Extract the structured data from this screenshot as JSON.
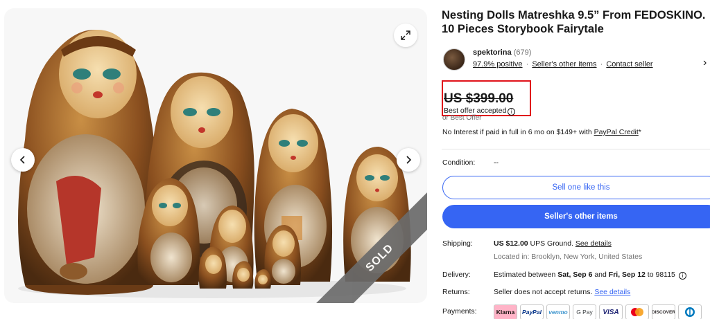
{
  "listing": {
    "title": "Nesting Dolls Matreshka 9.5” From FEDOSKINO. 10 Pieces Storybook Fairytale",
    "sold_ribbon": "SOLD"
  },
  "seller": {
    "name": "spektorina",
    "feedback_count": "(679)",
    "positive": "97.9% positive",
    "other_items_link": "Seller's other items",
    "contact_link": "Contact seller",
    "chevron": "›"
  },
  "pricing": {
    "price": "US $399.00",
    "offer_status": "Best offer accepted",
    "or_best_offer": "or Best Offer",
    "credit_text": "No Interest if paid in full in 6 mo on $149+ with ",
    "credit_link": "PayPal Credit",
    "credit_suffix": "*"
  },
  "condition": {
    "label": "Condition:",
    "value": "--"
  },
  "buttons": {
    "sell_one": "Sell one like this",
    "sellers_other": "Seller's other items"
  },
  "shipping": {
    "label": "Shipping:",
    "cost": "US $12.00",
    "method": " UPS Ground. ",
    "details_link": "See details",
    "location": "Located in: Brooklyn, New York, United States"
  },
  "delivery": {
    "label": "Delivery:",
    "prefix": "Estimated between ",
    "start": "Sat, Sep 6",
    "and": " and ",
    "end": "Fri, Sep 12",
    "to": " to 98115"
  },
  "returns": {
    "label": "Returns:",
    "text": "Seller does not accept returns. ",
    "details_link": "See details"
  },
  "payments": {
    "label": "Payments:",
    "methods": [
      "Klarna",
      "PayPal",
      "venmo",
      "G Pay",
      "VISA",
      "",
      "DISCOVER",
      ""
    ]
  },
  "icons": {
    "expand": "expand-icon",
    "prev": "chevron-left-icon",
    "next": "chevron-right-icon",
    "info": "info-icon"
  },
  "colors": {
    "primary": "#3665f3",
    "highlight_box": "#e0121a",
    "sold_ribbon": "#6b6b6b"
  }
}
